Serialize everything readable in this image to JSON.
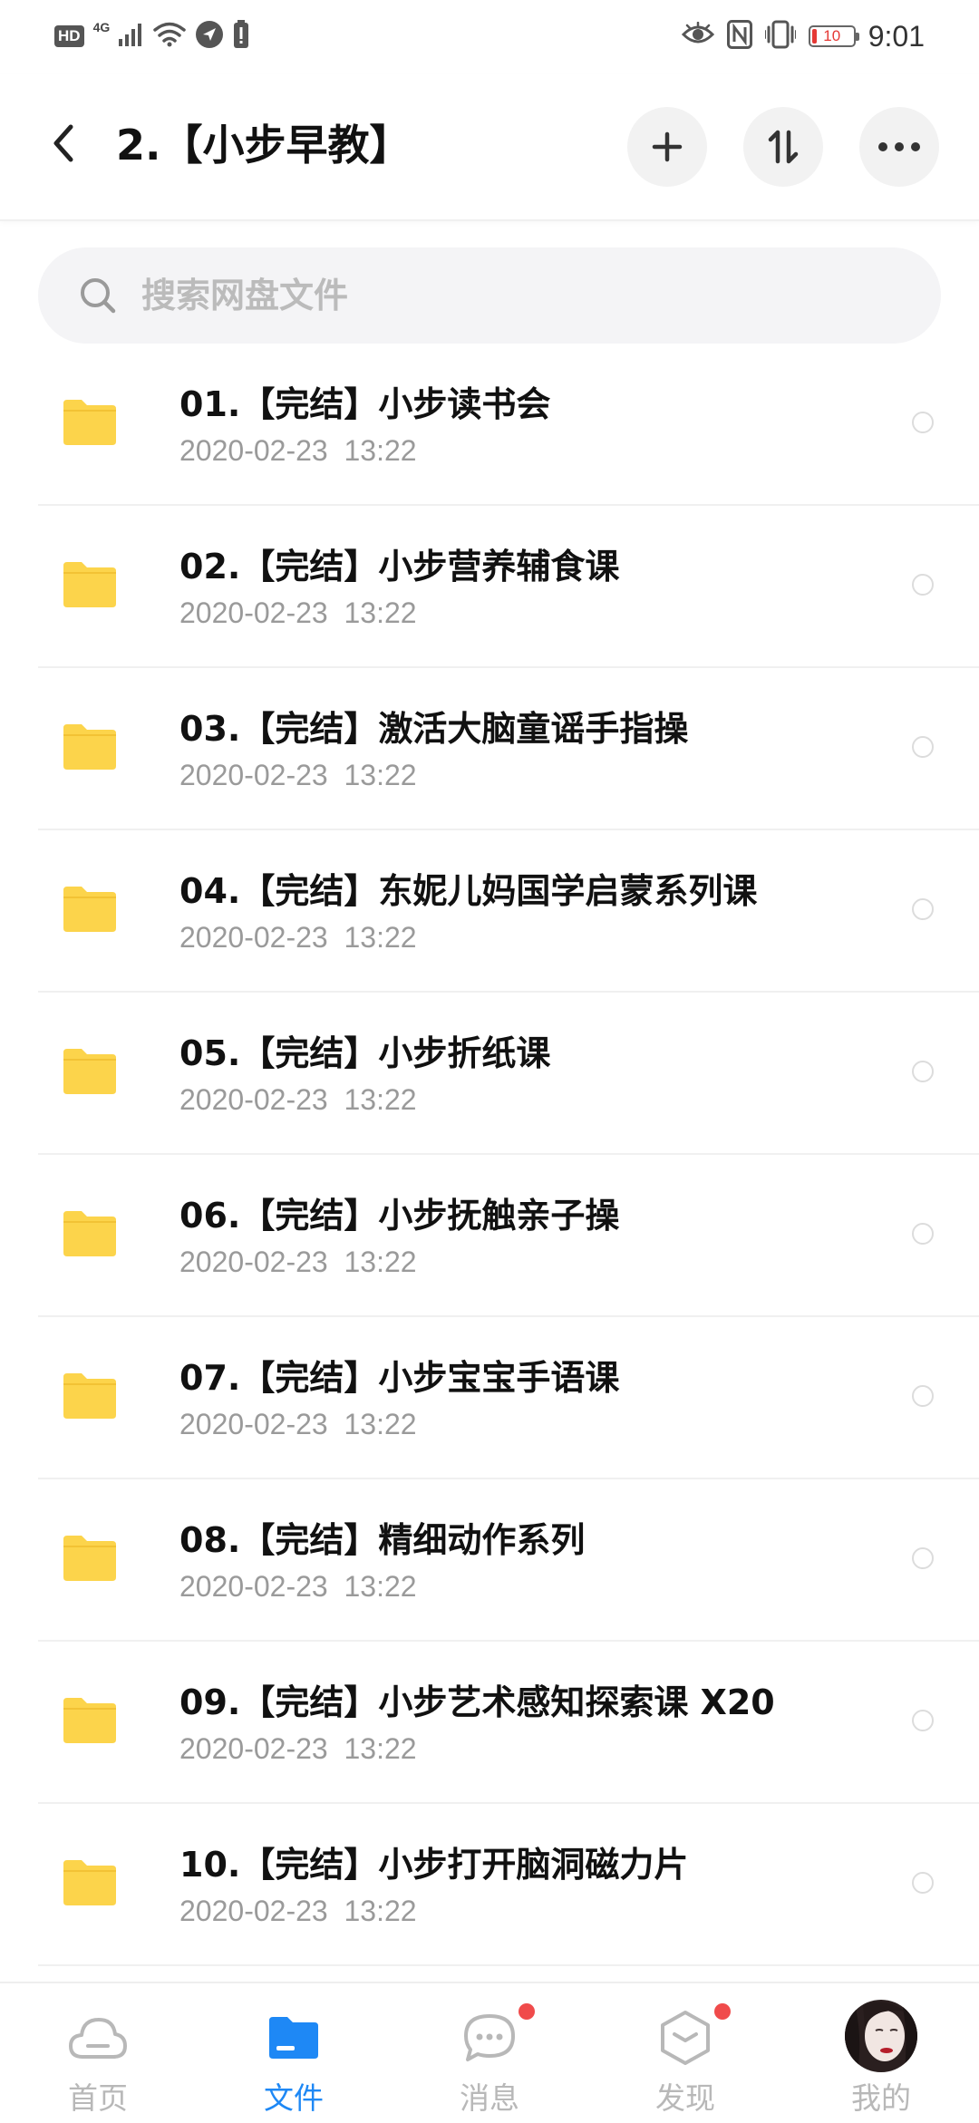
{
  "status_bar": {
    "hd": "HD",
    "signal_label": "4G",
    "battery": "10",
    "time": "9:01"
  },
  "header": {
    "title": "2.【小步早教】"
  },
  "search": {
    "placeholder": "搜索网盘文件"
  },
  "files": [
    {
      "name": "01.【完结】小步读书会",
      "date": "2020-02-23  13:22"
    },
    {
      "name": "02.【完结】小步营养辅食课",
      "date": "2020-02-23  13:22"
    },
    {
      "name": "03.【完结】激活大脑童谣手指操",
      "date": "2020-02-23  13:22"
    },
    {
      "name": "04.【完结】东妮儿妈国学启蒙系列课",
      "date": "2020-02-23  13:22"
    },
    {
      "name": "05.【完结】小步折纸课",
      "date": "2020-02-23  13:22"
    },
    {
      "name": "06.【完结】小步抚触亲子操",
      "date": "2020-02-23  13:22"
    },
    {
      "name": "07.【完结】小步宝宝手语课",
      "date": "2020-02-23  13:22"
    },
    {
      "name": "08.【完结】精细动作系列",
      "date": "2020-02-23  13:22"
    },
    {
      "name": "09.【完结】小步艺术感知探索课 X20",
      "date": "2020-02-23  13:22"
    },
    {
      "name": "10.【完结】小步打开脑洞磁力片",
      "date": "2020-02-23  13:22"
    }
  ],
  "nav": {
    "home": "首页",
    "files": "文件",
    "messages": "消息",
    "discover": "发现",
    "mine": "我的"
  },
  "colors": {
    "accent": "#1e88f5",
    "folder": "#fcd44b",
    "badge": "#f04b4b"
  }
}
